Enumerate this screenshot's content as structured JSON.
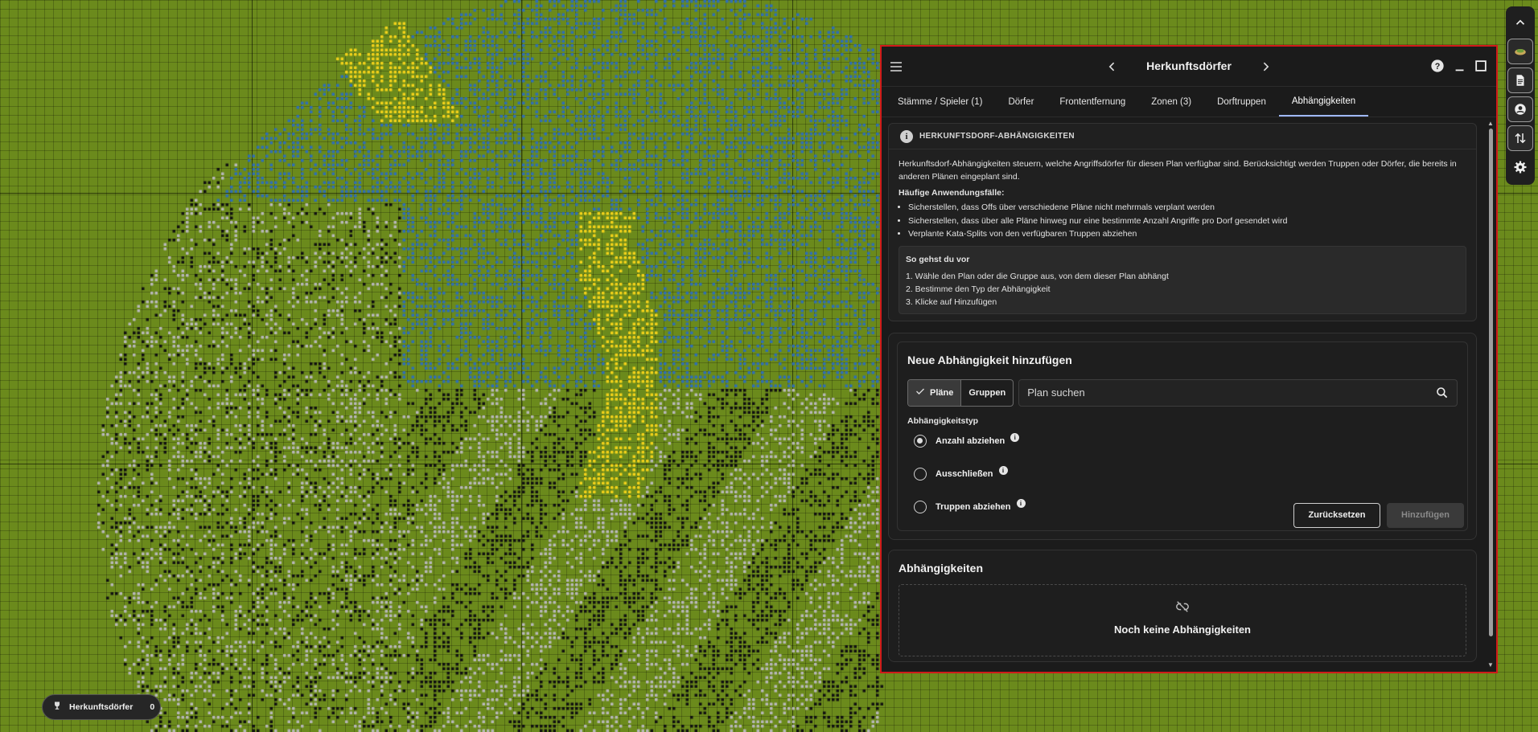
{
  "map": {
    "colors": {
      "grass": "#6b8a1c",
      "blue": "#2f6fb5",
      "yellow": "#f2d21a",
      "grey": "#b8b8b8",
      "black": "#111111",
      "red": "#c0281a"
    }
  },
  "toolbar": {
    "icons": [
      "chevron-up-icon",
      "map-layers-icon",
      "document-icon",
      "account-circle-icon",
      "swap-vertical-icon",
      "gear-icon"
    ]
  },
  "panel": {
    "title": "Herkunftsdörfer",
    "border_color": "#d11a1a",
    "tabs": [
      {
        "label": "Stämme / Spieler (1)",
        "active": false
      },
      {
        "label": "Dörfer",
        "active": false
      },
      {
        "label": "Frontentfernung",
        "active": false
      },
      {
        "label": "Zonen (3)",
        "active": false
      },
      {
        "label": "Dorftruppen",
        "active": false
      },
      {
        "label": "Abhängigkeiten",
        "active": true
      }
    ],
    "info": {
      "title": "HERKUNFTSDORF-ABHÄNGIGKEITEN",
      "intro": "Herkunftsdorf-Abhängigkeiten steuern, welche Angriffsdörfer für diesen Plan verfügbar sind. Berücksichtigt werden Truppen oder Dörfer, die bereits in anderen Plänen eingeplant sind.",
      "use_cases_title": "Häufige Anwendungsfälle:",
      "use_cases": [
        "Sicherstellen, dass Offs über verschiedene Pläne nicht mehrmals verplant werden",
        "Sicherstellen, dass über alle Pläne hinweg nur eine bestimmte Anzahl Angriffe pro Dorf gesendet wird",
        "Verplante Kata-Splits von den verfügbaren Truppen abziehen"
      ],
      "steps_title": "So gehst du vor",
      "steps": [
        "1. Wähle den Plan oder die Gruppe aus, von dem dieser Plan abhängt",
        "2. Bestimme den Typ der Abhängigkeit",
        "3. Klicke auf Hinzufügen"
      ]
    },
    "add_form": {
      "title": "Neue Abhängigkeit hinzufügen",
      "seg_plans": "Pläne",
      "seg_groups": "Gruppen",
      "search_placeholder": "Plan suchen",
      "type_label": "Abhängigkeitstyp",
      "options": [
        {
          "label": "Anzahl abziehen",
          "checked": true
        },
        {
          "label": "Ausschließen",
          "checked": false
        },
        {
          "label": "Truppen abziehen",
          "checked": false
        }
      ],
      "reset_label": "Zurücksetzen",
      "add_label": "Hinzufügen"
    },
    "dependencies": {
      "title": "Abhängigkeiten",
      "empty_text": "Noch keine Abhängigkeiten"
    }
  },
  "badge": {
    "label": "Herkunftsdörfer",
    "count": "0"
  }
}
